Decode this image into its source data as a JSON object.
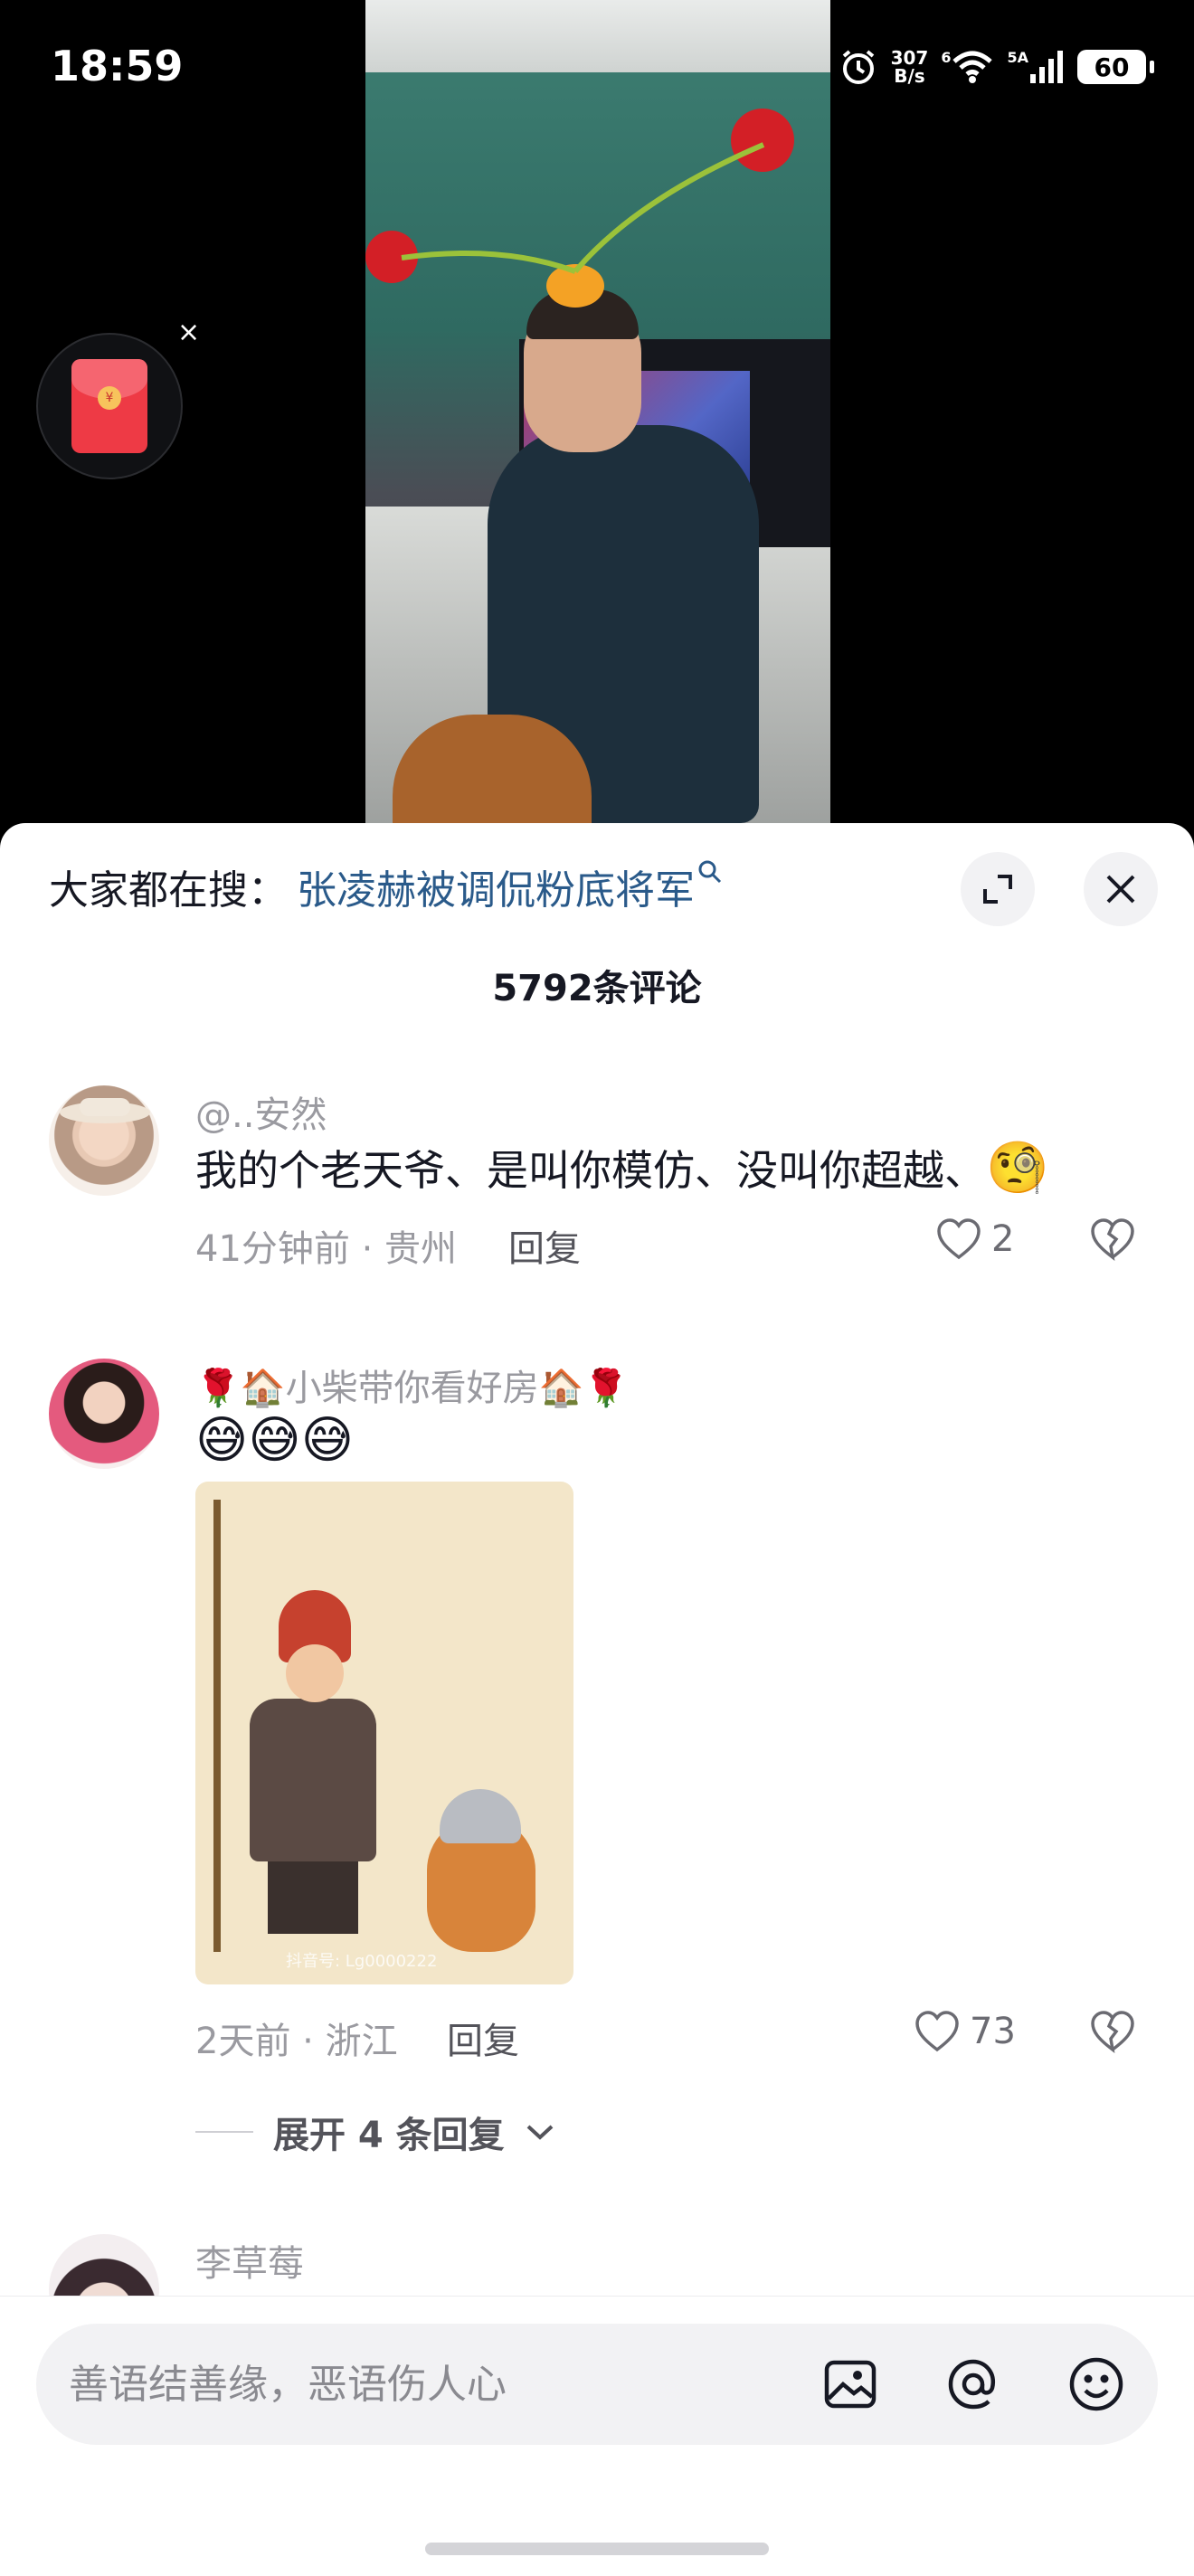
{
  "status_bar": {
    "time": "18:59",
    "net_speed_value": "307",
    "net_speed_unit": "B/s",
    "wifi_label": "6",
    "cell_label": "5A",
    "battery": "60"
  },
  "video": {
    "redpacket_close": "×",
    "redpacket_coin": "¥"
  },
  "sheet": {
    "search_prefix": "大家都在搜：",
    "search_link": "张凌赫被调侃粉底将军",
    "comment_count": "5792条评论"
  },
  "comments": [
    {
      "username": "@..安然",
      "text": "我的个老天爷、是叫你模仿、没叫你超越、",
      "emoji": "🧐",
      "time_location": "41分钟前 · 贵州",
      "reply_label": "回复",
      "likes": "2"
    },
    {
      "username": "🌹🏠小柴带你看好房🏠🌹",
      "emojis": [
        "😅",
        "😅",
        "😅"
      ],
      "image_watermark": "抖音号: Lg0000222",
      "time_location": "2天前 · 浙江",
      "reply_label": "回复",
      "likes": "73",
      "expand_label": "展开 4 条回复"
    },
    {
      "username": "李草莓"
    }
  ],
  "input_bar": {
    "placeholder": "善语结善缘，恶语伤人心"
  },
  "colors": {
    "link_blue": "#2a5a8a",
    "meta_gray": "#9a9aa0",
    "text_dark": "#161823"
  }
}
